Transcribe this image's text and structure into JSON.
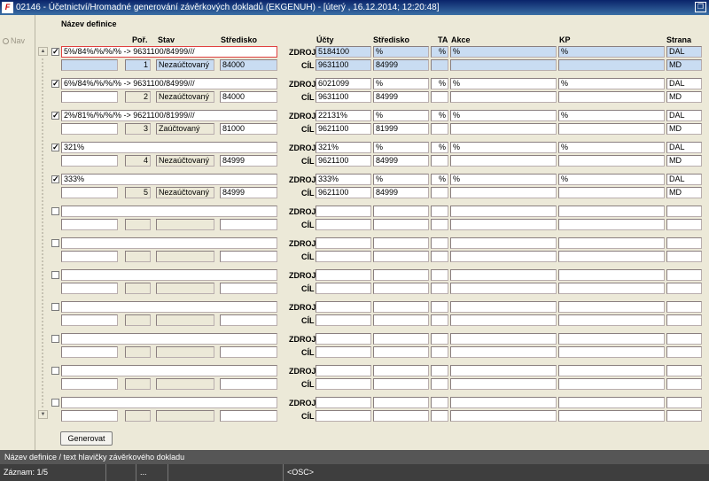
{
  "window": {
    "title": "02146 - Účetnictví/Hromadné generování závěrkových dokladů (EKGENUH) - [úterý  , 16.12.2014; 12:20:48]"
  },
  "nav": {
    "label": "Nav"
  },
  "headers": {
    "nazev": "Název definice",
    "por": "Poř.",
    "stav": "Stav",
    "stredisko": "Středisko",
    "ucty": "Účty",
    "stredisko2": "Středisko",
    "ta": "TA",
    "akce": "Akce",
    "kp": "KP",
    "strana": "Strana"
  },
  "labels": {
    "zdroj": "ZDROJ",
    "cil": "CÍL"
  },
  "records": [
    {
      "checked": true,
      "name": "5%/84%/%/%/% -> 9631100/84999///",
      "por": "1",
      "stav": "Nezaúčtovaný",
      "stredisko": "84000",
      "zdroj_ucet": "5184100",
      "zdroj_stred": "%",
      "zdroj_ta": "%",
      "zdroj_akce": "%",
      "zdroj_kp": "%",
      "zdroj_strana": "DAL",
      "cil_ucet": "9631100",
      "cil_stred": "84999",
      "cil_strana": "MD"
    },
    {
      "checked": true,
      "name": "6%/84%/%/%/% -> 9631100/84999///",
      "por": "2",
      "stav": "Nezaúčtovaný",
      "stredisko": "84000",
      "zdroj_ucet": "6021099",
      "zdroj_stred": "%",
      "zdroj_ta": "%",
      "zdroj_akce": "%",
      "zdroj_kp": "%",
      "zdroj_strana": "DAL",
      "cil_ucet": "9631100",
      "cil_stred": "84999",
      "cil_strana": "MD"
    },
    {
      "checked": true,
      "name": "2%/81%/%/%/% -> 9621100/81999///",
      "por": "3",
      "stav": "Zaúčtovaný",
      "stredisko": "81000",
      "zdroj_ucet": "22131%",
      "zdroj_stred": "%",
      "zdroj_ta": "%",
      "zdroj_akce": "%",
      "zdroj_kp": "%",
      "zdroj_strana": "DAL",
      "cil_ucet": "9621100",
      "cil_stred": "81999",
      "cil_strana": "MD"
    },
    {
      "checked": true,
      "name": "321%",
      "por": "4",
      "stav": "Nezaúčtovaný",
      "stredisko": "84999",
      "zdroj_ucet": "321%",
      "zdroj_stred": "%",
      "zdroj_ta": "%",
      "zdroj_akce": "%",
      "zdroj_kp": "%",
      "zdroj_strana": "DAL",
      "cil_ucet": "9621100",
      "cil_stred": "84999",
      "cil_strana": "MD"
    },
    {
      "checked": true,
      "name": "333%",
      "por": "5",
      "stav": "Nezaúčtovaný",
      "stredisko": "84999",
      "zdroj_ucet": "333%",
      "zdroj_stred": "%",
      "zdroj_ta": "%",
      "zdroj_akce": "%",
      "zdroj_kp": "%",
      "zdroj_strana": "DAL",
      "cil_ucet": "9621100",
      "cil_stred": "84999",
      "cil_strana": "MD"
    },
    {
      "checked": false,
      "name": "",
      "por": "",
      "stav": "",
      "stredisko": "",
      "zdroj_ucet": "",
      "zdroj_stred": "",
      "zdroj_ta": "",
      "zdroj_akce": "",
      "zdroj_kp": "",
      "zdroj_strana": "",
      "cil_ucet": "",
      "cil_stred": "",
      "cil_strana": ""
    },
    {
      "checked": false,
      "name": "",
      "por": "",
      "stav": "",
      "stredisko": "",
      "zdroj_ucet": "",
      "zdroj_stred": "",
      "zdroj_ta": "",
      "zdroj_akce": "",
      "zdroj_kp": "",
      "zdroj_strana": "",
      "cil_ucet": "",
      "cil_stred": "",
      "cil_strana": ""
    },
    {
      "checked": false,
      "name": "",
      "por": "",
      "stav": "",
      "stredisko": "",
      "zdroj_ucet": "",
      "zdroj_stred": "",
      "zdroj_ta": "",
      "zdroj_akce": "",
      "zdroj_kp": "",
      "zdroj_strana": "",
      "cil_ucet": "",
      "cil_stred": "",
      "cil_strana": ""
    },
    {
      "checked": false,
      "name": "",
      "por": "",
      "stav": "",
      "stredisko": "",
      "zdroj_ucet": "",
      "zdroj_stred": "",
      "zdroj_ta": "",
      "zdroj_akce": "",
      "zdroj_kp": "",
      "zdroj_strana": "",
      "cil_ucet": "",
      "cil_stred": "",
      "cil_strana": ""
    },
    {
      "checked": false,
      "name": "",
      "por": "",
      "stav": "",
      "stredisko": "",
      "zdroj_ucet": "",
      "zdroj_stred": "",
      "zdroj_ta": "",
      "zdroj_akce": "",
      "zdroj_kp": "",
      "zdroj_strana": "",
      "cil_ucet": "",
      "cil_stred": "",
      "cil_strana": ""
    },
    {
      "checked": false,
      "name": "",
      "por": "",
      "stav": "",
      "stredisko": "",
      "zdroj_ucet": "",
      "zdroj_stred": "",
      "zdroj_ta": "",
      "zdroj_akce": "",
      "zdroj_kp": "",
      "zdroj_strana": "",
      "cil_ucet": "",
      "cil_stred": "",
      "cil_strana": ""
    },
    {
      "checked": false,
      "name": "",
      "por": "",
      "stav": "",
      "stredisko": "",
      "zdroj_ucet": "",
      "zdroj_stred": "",
      "zdroj_ta": "",
      "zdroj_akce": "",
      "zdroj_kp": "",
      "zdroj_strana": "",
      "cil_ucet": "",
      "cil_stred": "",
      "cil_strana": ""
    }
  ],
  "buttons": {
    "generate": "Generovat"
  },
  "status": {
    "message": "Název definice / text hlavičky závěrkového dokladu",
    "record": "Záznam: 1/5",
    "seg2": "",
    "seg3": "...",
    "seg4": "",
    "seg5": "<OSC>"
  }
}
